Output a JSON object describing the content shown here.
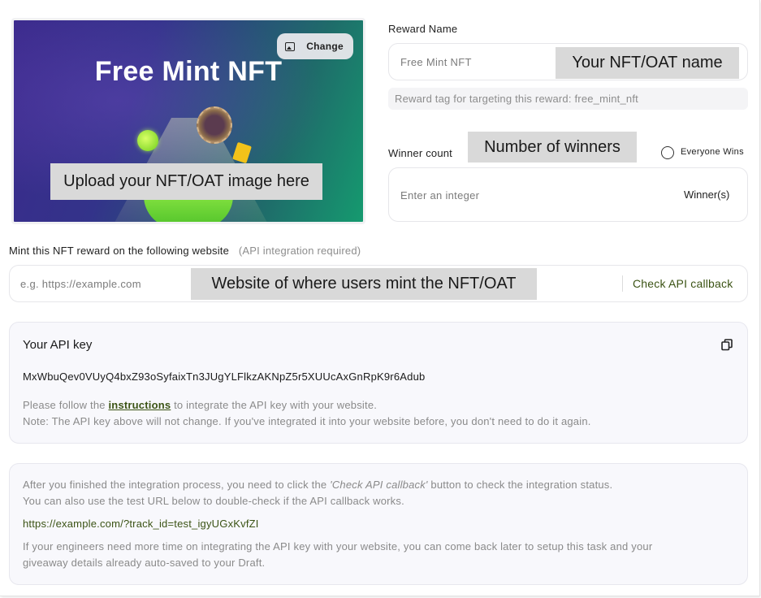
{
  "image_card": {
    "title": "Free Mint NFT",
    "change_label": "Change",
    "change_icon": "image-icon",
    "annotation": "Upload your NFT/OAT image here"
  },
  "reward_name": {
    "label": "Reward Name",
    "placeholder": "Free Mint NFT",
    "annotation": "Your NFT/OAT name",
    "tag_text": "Reward tag for targeting this reward: free_mint_nft"
  },
  "winner_count": {
    "label": "Winner count",
    "annotation": "Number of winners",
    "everyone_wins_label": "Everyone Wins",
    "placeholder": "Enter an integer",
    "suffix": "Winner(s)"
  },
  "mint_website": {
    "label": "Mint this NFT reward on the following website",
    "note": "(API integration required)",
    "placeholder": "e.g. https://example.com",
    "annotation": "Website of where users mint the NFT/OAT",
    "check_button": "Check API callback"
  },
  "api_panel": {
    "title": "Your API key",
    "copy_icon": "copy-icon",
    "api_key": "MxWbuQev0VUyQ4bxZ93oSyfaixTn3JUgYLFlkzAKNpZ5r5XUUcAxGnRpK9r6Adub",
    "follow_prefix": "Please follow the ",
    "instructions_link": "instructions",
    "follow_suffix": " to integrate the API key with your website.",
    "note": "Note: The API key above will not change. If you've integrated it into your website before, you don't need to do it again."
  },
  "callback_panel": {
    "line1_prefix": "After you finished the integration process, you need to click the ",
    "line1_emphasis": "'Check API callback'",
    "line1_suffix": " button to check the integration status.",
    "line2": "You can also use the test URL below to double-check if the API callback works.",
    "test_url": "https://example.com/?track_id=test_igyUGxKvfZI",
    "line3": "If your engineers need more time on integrating the API key with your website, you can come back later to setup this task and your",
    "line4": "giveaway details already auto-saved to your Draft."
  },
  "colors": {
    "link_green": "#3b5314",
    "annotation_gray": "#d9d9d9",
    "panel_bg": "#f8f8fc"
  }
}
